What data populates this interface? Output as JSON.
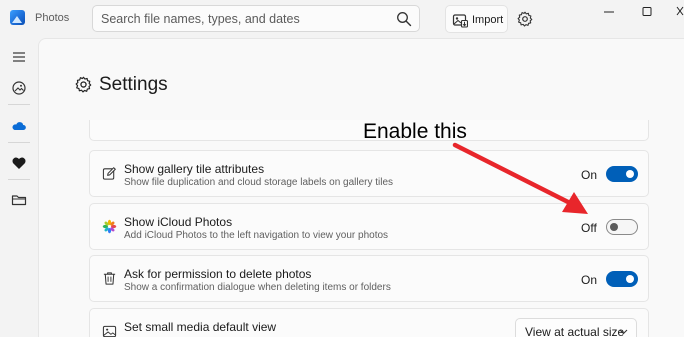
{
  "app": {
    "title": "Photos"
  },
  "search": {
    "placeholder": "Search file names, types, and dates"
  },
  "toolbar": {
    "import_label": "Import"
  },
  "page": {
    "title": "Settings"
  },
  "settings_rows": [
    {
      "title": "Show gallery tile attributes",
      "subtitle": "Show file duplication and cloud storage labels on gallery tiles",
      "state_label": "On",
      "enabled": true
    },
    {
      "title": "Show iCloud Photos",
      "subtitle": "Add iCloud Photos to the left navigation to view your photos",
      "state_label": "Off",
      "enabled": false
    },
    {
      "title": "Ask for permission to delete photos",
      "subtitle": "Show a confirmation dialogue when deleting items or folders",
      "state_label": "On",
      "enabled": true
    },
    {
      "title": "Set small media default view",
      "dropdown_value": "View at actual size"
    }
  ],
  "annotation": {
    "text": "Enable this",
    "arrow_color": "#e8262b"
  },
  "colors": {
    "accent": "#005fb8"
  },
  "icons": {
    "sidebar": [
      "hamburger-menu-icon",
      "gallery-icon",
      "onedrive-cloud-icon",
      "favorites-heart-icon",
      "folder-icon"
    ]
  }
}
